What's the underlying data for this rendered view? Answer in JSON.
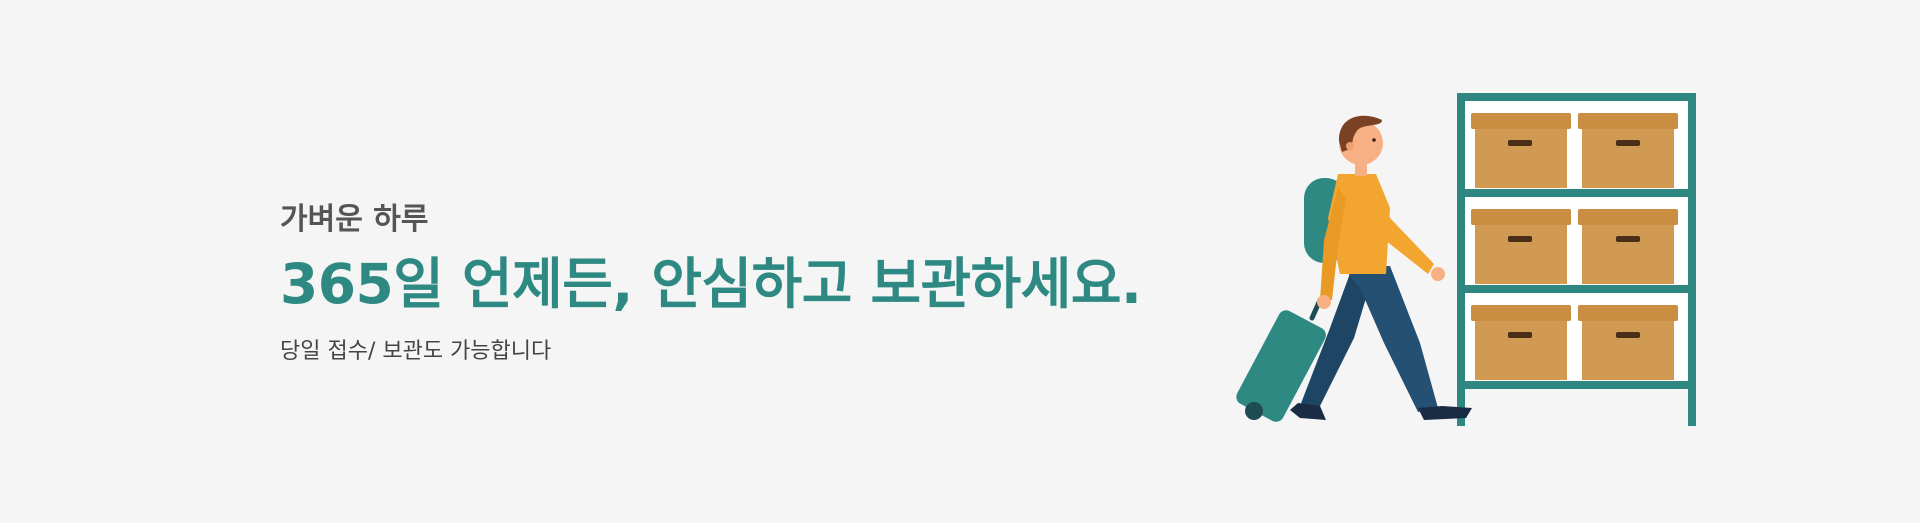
{
  "banner": {
    "eyebrow": "가벼운 하루",
    "headline": "365일 언제든, 안심하고 보관하세요.",
    "subline": "당일 접수/ 보관도 가능합니다"
  },
  "colors": {
    "background": "#f5f5f5",
    "accent": "#2e8983",
    "shelf": "#2e8780",
    "box": "#d09a52",
    "shirt": "#f2a52f",
    "pants": "#245073",
    "suitcase": "#2e8983"
  },
  "illustration": {
    "icons": [
      "shelf-icon",
      "storage-box-icon",
      "person-icon",
      "suitcase-icon",
      "backpack-icon"
    ]
  }
}
